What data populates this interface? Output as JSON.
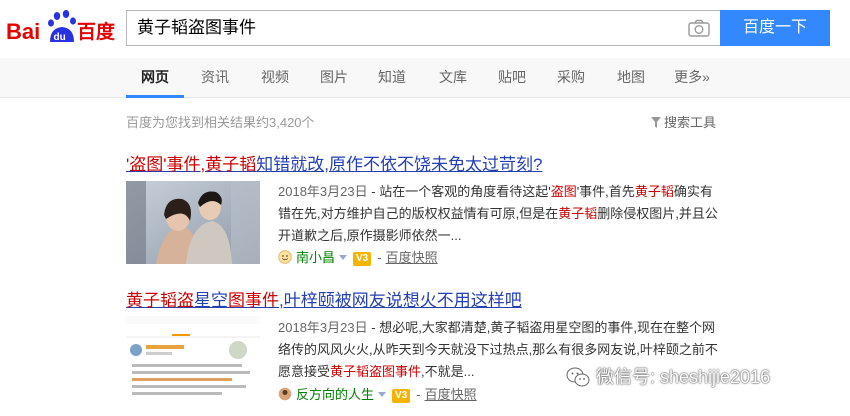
{
  "logo": {
    "text_bai": "Bai",
    "text_du": "du",
    "text_cn": "百度"
  },
  "search": {
    "query": "黄子韬盗图事件",
    "button_label": "百度一下"
  },
  "tabs": [
    {
      "label": "网页"
    },
    {
      "label": "资讯"
    },
    {
      "label": "视频"
    },
    {
      "label": "图片"
    },
    {
      "label": "知道"
    },
    {
      "label": "文库"
    },
    {
      "label": "贴吧"
    },
    {
      "label": "采购"
    },
    {
      "label": "地图"
    },
    {
      "label": "更多»"
    }
  ],
  "stats": {
    "text": "百度为您找到相关结果约3,420个",
    "tools": "搜索工具"
  },
  "results": [
    {
      "title_parts": [
        "'盗图'事件,黄子韬",
        "知错就改,原作不依不饶未免太过苛刻?"
      ],
      "date": "2018年3月23日",
      "abstract": [
        "- 站在一个客观的角度看待这起'",
        "盗图",
        "'事件,首先",
        "黄子韬",
        "确实有错在先,对方维护自己的版权权益情有可原,但是在",
        "黄子韬",
        "删除侵权图片,并且公开道歉之后,原作摄影师依然一..."
      ],
      "source": "南小昌",
      "badge": "V3",
      "snapshot": "百度快照"
    },
    {
      "title_parts": [
        "黄子韬盗",
        "星空",
        "图事件",
        ",叶梓颐被网友说想火不用这样吧"
      ],
      "date": "2018年3月23日",
      "abstract": [
        "- 想必呢,大家都清楚,黄子韬盗用星空图的事件,现在在整个网络传的风风火火,从昨天到今天就没下过热点,那么有很多网友说,叶梓颐之前不愿意接受",
        "黄子韬盗图事件",
        ",不就是..."
      ],
      "source": "反方向的人生",
      "badge": "V3",
      "snapshot": "百度快照"
    }
  ],
  "watermark": "微信号: sheshijie2016",
  "colors": {
    "link": "#2440b3",
    "highlight": "#cc0000",
    "button": "#3388ff",
    "source": "#008000"
  }
}
